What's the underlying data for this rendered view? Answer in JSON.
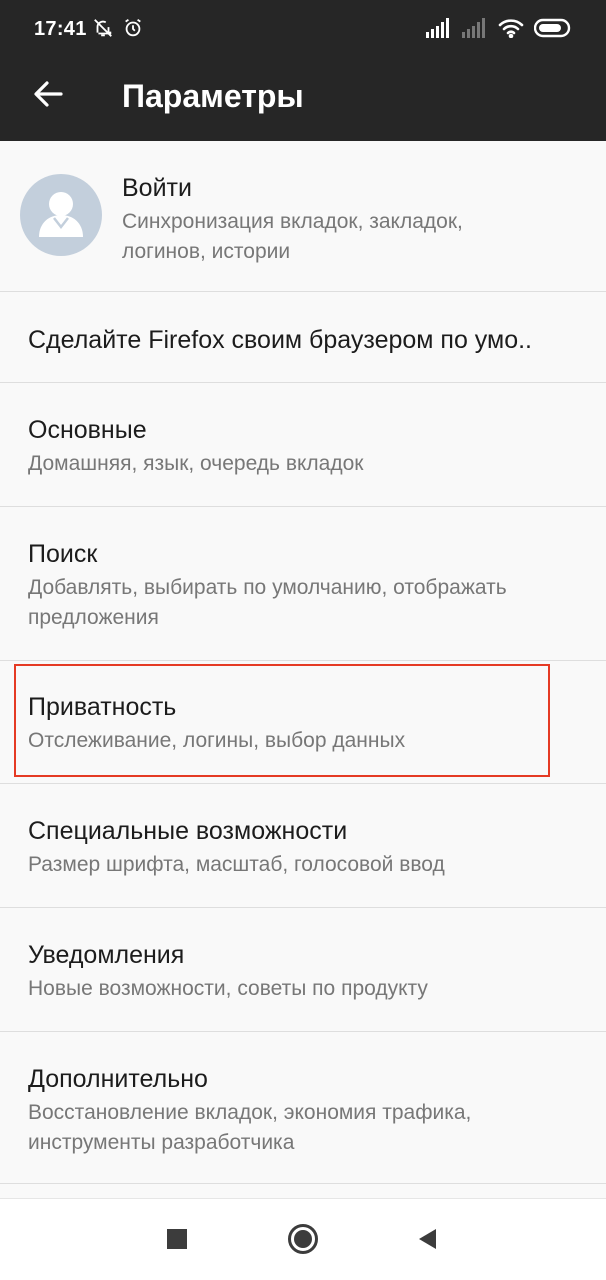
{
  "status_bar": {
    "time": "17:41",
    "left_icons": [
      "bell-off-icon",
      "alarm-icon"
    ],
    "right_icons": [
      "signal-icon",
      "signal-no-service-icon",
      "wifi-icon",
      "battery-icon"
    ]
  },
  "toolbar": {
    "back_icon": "arrow-back-icon",
    "title": "Параметры"
  },
  "account": {
    "title": "Войти",
    "subtitle_line1": "Синхронизация вкладок, закладок,",
    "subtitle_line2": "логинов, истории",
    "avatar_color": "#c3cfdc"
  },
  "default_browser": {
    "title": "Сделайте Firefox своим браузером по умо.."
  },
  "items": [
    {
      "title": "Основные",
      "subtitle": [
        "Домашняя, язык, очередь вкладок"
      ]
    },
    {
      "title": "Поиск",
      "subtitle": [
        "Добавлять, выбирать по умолчанию, отображать",
        "предложения"
      ]
    },
    {
      "title": "Приватность",
      "subtitle": [
        "Отслеживание, логины, выбор данных"
      ]
    },
    {
      "title": "Специальные возможности",
      "subtitle": [
        "Размер шрифта, масштаб, голосовой ввод"
      ]
    },
    {
      "title": "Уведомления",
      "subtitle": [
        "Новые возможности, советы по продукту"
      ]
    },
    {
      "title": "Дополнительно",
      "subtitle": [
        "Восстановление вкладок, экономия трафика,",
        "инструменты разработчика"
      ]
    }
  ],
  "highlight_color": "#e53a24",
  "navbar": {
    "icons": [
      "recents-square-icon",
      "home-circle-icon",
      "back-triangle-icon"
    ]
  }
}
